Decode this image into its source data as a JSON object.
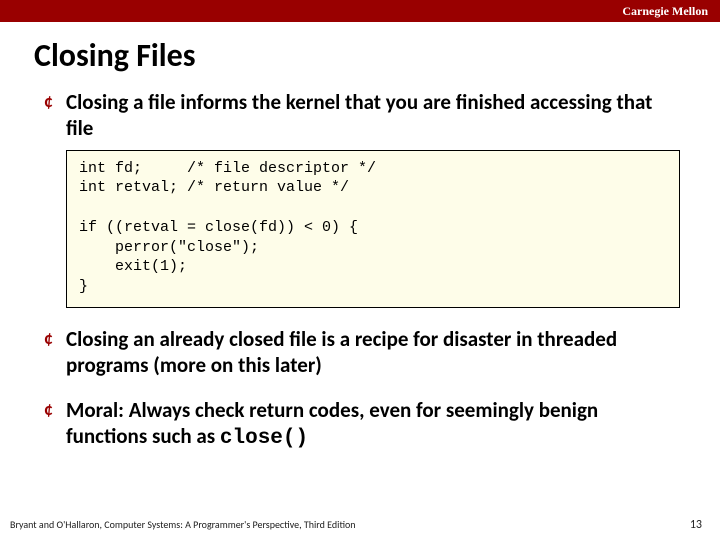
{
  "header": {
    "brand": "Carnegie Mellon"
  },
  "title": "Closing Files",
  "bullets": {
    "b1": "Closing a file informs the kernel that you are finished accessing that file",
    "b2": "Closing an already closed file is a recipe for disaster in threaded programs (more on this later)",
    "b3_pre": "Moral: Always check return codes, even for seemingly benign functions such as ",
    "b3_code": "close()"
  },
  "code": "int fd;     /* file descriptor */\nint retval; /* return value */\n\nif ((retval = close(fd)) < 0) {\n    perror(\"close\");\n    exit(1);\n}",
  "footer": {
    "left": "Bryant and O'Hallaron, Computer Systems: A Programmer's Perspective, Third Edition",
    "right": "13"
  },
  "glyphs": {
    "bullet": "¢"
  }
}
